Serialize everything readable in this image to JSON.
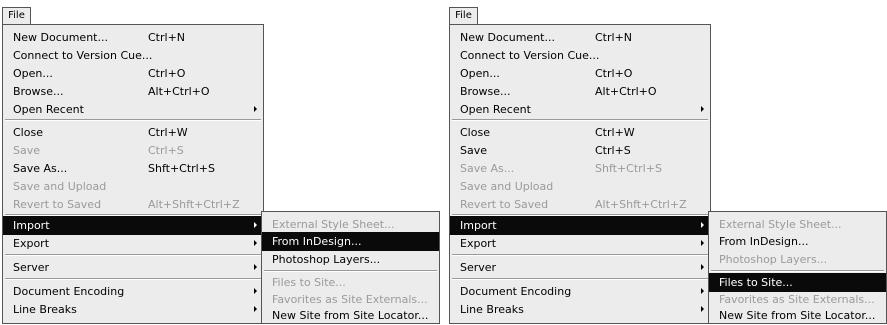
{
  "file_tab": "File",
  "panels": [
    {
      "main": [
        {
          "label": "New Document...",
          "shortcut": "Ctrl+N",
          "disabled": false
        },
        {
          "label": "Connect to Version Cue...",
          "shortcut": "",
          "disabled": false
        },
        {
          "label": "Open...",
          "shortcut": "Ctrl+O",
          "disabled": false
        },
        {
          "label": "Browse...",
          "shortcut": "Alt+Ctrl+O",
          "disabled": false
        },
        {
          "label": "Open Recent",
          "shortcut": "",
          "disabled": false
        },
        {
          "label": "Close",
          "shortcut": "Ctrl+W",
          "disabled": false
        },
        {
          "label": "Save",
          "shortcut": "Ctrl+S",
          "disabled": true
        },
        {
          "label": "Save As...",
          "shortcut": "Shft+Ctrl+S",
          "disabled": false
        },
        {
          "label": "Save and Upload",
          "shortcut": "",
          "disabled": true
        },
        {
          "label": "Revert to Saved",
          "shortcut": "Alt+Shft+Ctrl+Z",
          "disabled": true
        },
        {
          "label": "Import",
          "shortcut": "",
          "disabled": false
        },
        {
          "label": "Export",
          "shortcut": "",
          "disabled": false
        },
        {
          "label": "Server",
          "shortcut": "",
          "disabled": false
        },
        {
          "label": "Document Encoding",
          "shortcut": "",
          "disabled": false
        },
        {
          "label": "Line Breaks",
          "shortcut": "",
          "disabled": false
        }
      ],
      "sub": [
        {
          "label": "External Style Sheet...",
          "disabled": true
        },
        {
          "label": "From InDesign...",
          "disabled": false
        },
        {
          "label": "Photoshop Layers...",
          "disabled": false
        },
        {
          "label": "Files to Site...",
          "disabled": true
        },
        {
          "label": "Favorites as Site Externals...",
          "disabled": true
        },
        {
          "label": "New Site from Site Locator...",
          "disabled": false
        }
      ]
    },
    {
      "main": [
        {
          "label": "New Document...",
          "shortcut": "Ctrl+N",
          "disabled": false
        },
        {
          "label": "Connect to Version Cue...",
          "shortcut": "",
          "disabled": false
        },
        {
          "label": "Open...",
          "shortcut": "Ctrl+O",
          "disabled": false
        },
        {
          "label": "Browse...",
          "shortcut": "Alt+Ctrl+O",
          "disabled": false
        },
        {
          "label": "Open Recent",
          "shortcut": "",
          "disabled": false
        },
        {
          "label": "Close",
          "shortcut": "Ctrl+W",
          "disabled": false
        },
        {
          "label": "Save",
          "shortcut": "Ctrl+S",
          "disabled": false
        },
        {
          "label": "Save As...",
          "shortcut": "Shft+Ctrl+S",
          "disabled": true
        },
        {
          "label": "Save and Upload",
          "shortcut": "",
          "disabled": true
        },
        {
          "label": "Revert to Saved",
          "shortcut": "Alt+Shft+Ctrl+Z",
          "disabled": true
        },
        {
          "label": "Import",
          "shortcut": "",
          "disabled": false
        },
        {
          "label": "Export",
          "shortcut": "",
          "disabled": false
        },
        {
          "label": "Server",
          "shortcut": "",
          "disabled": false
        },
        {
          "label": "Document Encoding",
          "shortcut": "",
          "disabled": false
        },
        {
          "label": "Line Breaks",
          "shortcut": "",
          "disabled": false
        }
      ],
      "sub": [
        {
          "label": "External Style Sheet...",
          "disabled": true
        },
        {
          "label": "From InDesign...",
          "disabled": false
        },
        {
          "label": "Photoshop Layers...",
          "disabled": true
        },
        {
          "label": "Files to Site...",
          "disabled": false
        },
        {
          "label": "Favorites as Site Externals...",
          "disabled": true
        },
        {
          "label": "New Site from Site Locator...",
          "disabled": false
        }
      ]
    }
  ]
}
